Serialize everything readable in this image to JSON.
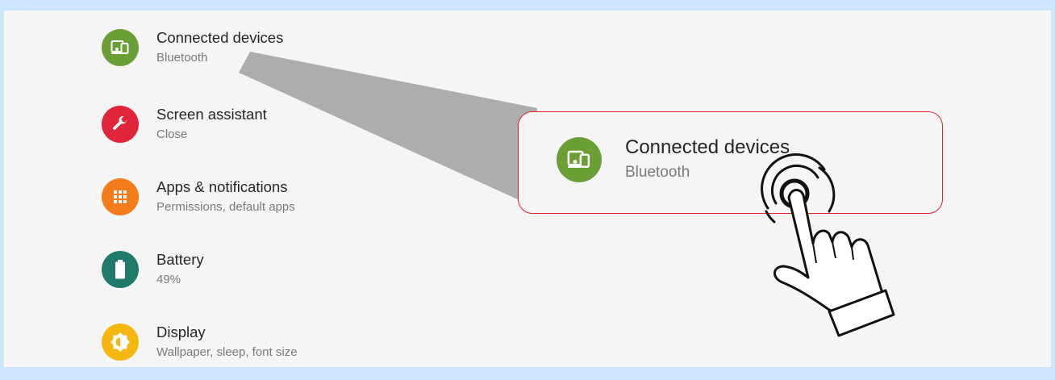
{
  "settings": {
    "items": [
      {
        "title": "Connected devices",
        "subtitle": "Bluetooth",
        "icon": "connected-devices-icon",
        "color": "#6c9e36"
      },
      {
        "title": "Screen assistant",
        "subtitle": "Close",
        "icon": "wrench-icon",
        "color": "#e0243a"
      },
      {
        "title": "Apps & notifications",
        "subtitle": "Permissions, default apps",
        "icon": "apps-grid-icon",
        "color": "#f57c1a"
      },
      {
        "title": "Battery",
        "subtitle": "49%",
        "icon": "battery-icon",
        "color": "#1f7a6a"
      },
      {
        "title": "Display",
        "subtitle": "Wallpaper, sleep, font size",
        "icon": "display-brightness-icon",
        "color": "#f6b612"
      }
    ]
  },
  "zoom": {
    "title": "Connected devices",
    "subtitle": "Bluetooth",
    "icon": "connected-devices-icon",
    "border_color": "#e8202c"
  },
  "overlay": {
    "gesture_icon": "tap-hand-icon"
  }
}
